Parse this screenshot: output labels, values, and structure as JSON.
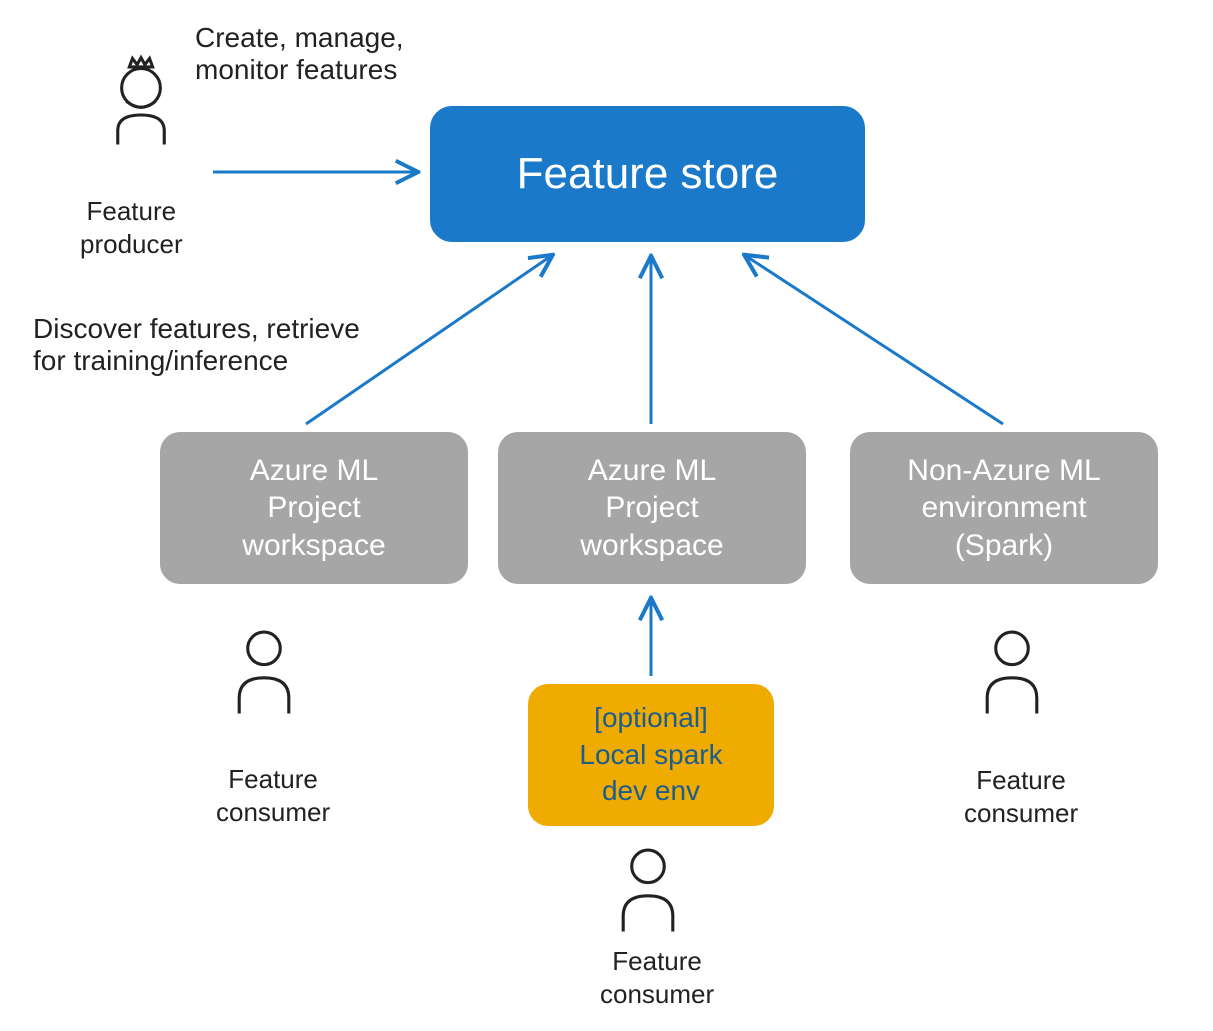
{
  "producer": {
    "label": "Feature\nproducer",
    "description": "Create, manage,\nmonitor features"
  },
  "feature_store": {
    "title": "Feature store"
  },
  "discover": {
    "description": "Discover features, retrieve\nfor training/inference"
  },
  "consumers": {
    "box1": "Azure ML\nProject\nworkspace",
    "box2": "Azure ML\nProject\nworkspace",
    "box3": "Non-Azure ML\nenvironment\n(Spark)",
    "label1": "Feature\nconsumer",
    "label2": "Feature\nconsumer",
    "label3": "Feature\nconsumer"
  },
  "optional": {
    "label": "[optional]\nLocal spark\ndev env"
  },
  "colors": {
    "blue": "#1b79c9",
    "gray": "#a6a6a6",
    "amber": "#f0ab00",
    "dark_blue_text": "#1b5d8f"
  }
}
